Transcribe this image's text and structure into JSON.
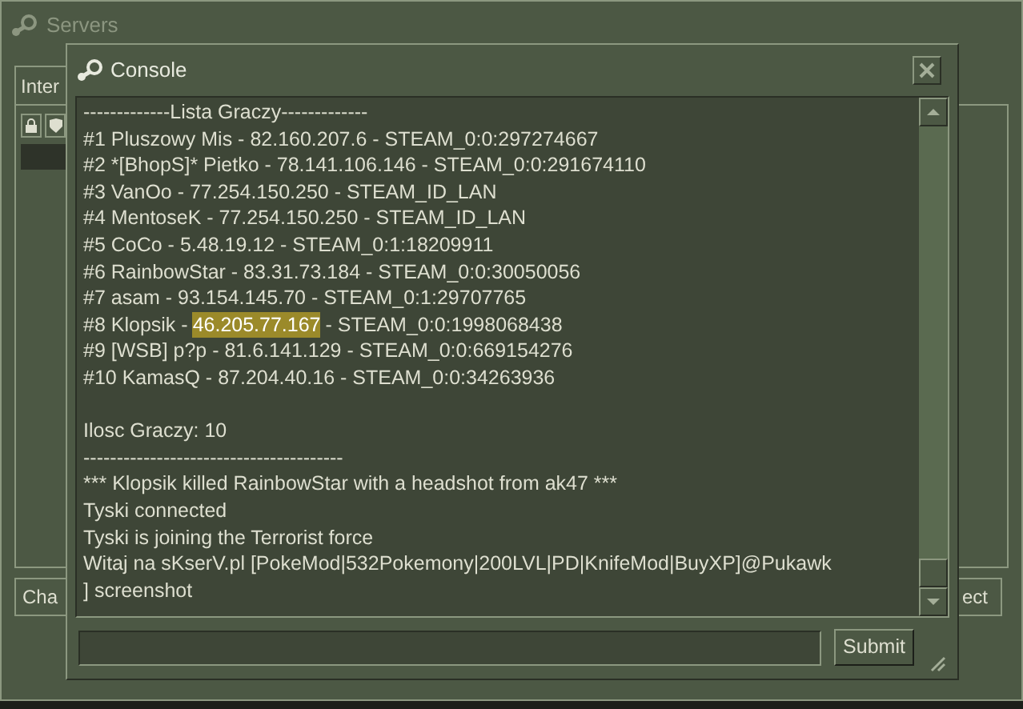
{
  "servers_window": {
    "title": "Servers",
    "tab": "Inter",
    "left_button": "Cha",
    "right_button": "ect"
  },
  "console": {
    "title": "Console",
    "lines": [
      {
        "segments": [
          {
            "text": "-------------Lista Graczy-------------",
            "selected": false
          }
        ]
      },
      {
        "segments": [
          {
            "text": "#1 Pluszowy Mis - 82.160.207.6 - STEAM_0:0:297274667",
            "selected": false
          }
        ]
      },
      {
        "segments": [
          {
            "text": "#2 *[BhopS]* Pietko - 78.141.106.146 - STEAM_0:0:291674110",
            "selected": false
          }
        ]
      },
      {
        "segments": [
          {
            "text": "#3 VanOo - 77.254.150.250 - STEAM_ID_LAN",
            "selected": false
          }
        ]
      },
      {
        "segments": [
          {
            "text": "#4 MentoseK - 77.254.150.250 - STEAM_ID_LAN",
            "selected": false
          }
        ]
      },
      {
        "segments": [
          {
            "text": "#5 CoCo - 5.48.19.12 - STEAM_0:1:18209911",
            "selected": false
          }
        ]
      },
      {
        "segments": [
          {
            "text": "#6 RainbowStar - 83.31.73.184 - STEAM_0:0:30050056",
            "selected": false
          }
        ]
      },
      {
        "segments": [
          {
            "text": "#7 asam - 93.154.145.70 - STEAM_0:1:29707765",
            "selected": false
          }
        ]
      },
      {
        "segments": [
          {
            "text": "#8 Klopsik -",
            "selected": false
          },
          {
            "text": "46.205.77.167",
            "selected": true
          },
          {
            "text": "- STEAM_0:0:1998068438",
            "selected": false
          }
        ]
      },
      {
        "segments": [
          {
            "text": "#9 [WSB] p?p - 81.6.141.129 - STEAM_0:0:669154276",
            "selected": false
          }
        ]
      },
      {
        "segments": [
          {
            "text": "#10 KamasQ - 87.204.40.16 - STEAM_0:0:34263936",
            "selected": false
          }
        ]
      },
      {
        "space_before": true,
        "segments": [
          {
            "text": "Ilosc Graczy: 10",
            "selected": false
          }
        ]
      },
      {
        "segments": [
          {
            "text": "---------------------------------------",
            "selected": false
          }
        ]
      },
      {
        "segments": [
          {
            "text": "*** Klopsik killed RainbowStar with a headshot from ak47 ***",
            "selected": false
          }
        ]
      },
      {
        "segments": [
          {
            "text": "Tyski connected",
            "selected": false
          }
        ]
      },
      {
        "segments": [
          {
            "text": "Tyski is joining the Terrorist force",
            "selected": false
          }
        ]
      },
      {
        "segments": [
          {
            "text": "Witaj na sKserV.pl [PokeMod|532Pokemony|200LVL|PD|KnifeMod|BuyXP]@Pukawk",
            "selected": false
          }
        ]
      },
      {
        "segments": [
          {
            "text": "] screenshot",
            "selected": false
          }
        ]
      }
    ],
    "submit_button": "Submit"
  }
}
